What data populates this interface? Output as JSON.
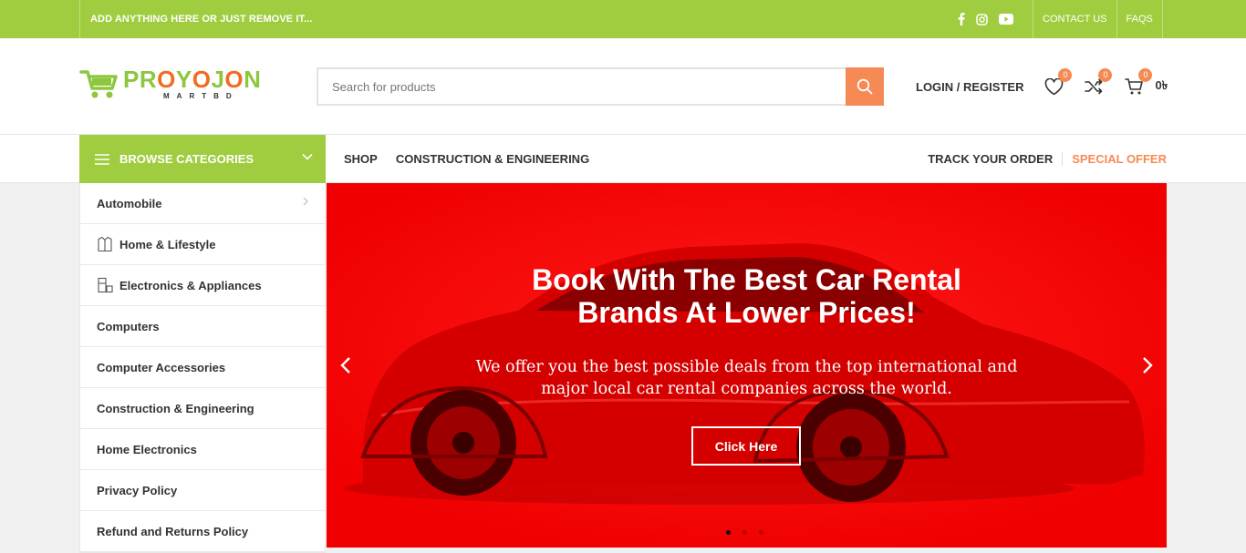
{
  "topbar": {
    "promo": "ADD ANYTHING HERE OR JUST REMOVE IT...",
    "social": [
      "facebook-icon",
      "instagram-icon",
      "youtube-icon"
    ],
    "links": [
      "CONTACT US",
      "FAQS"
    ]
  },
  "header": {
    "logo": {
      "name_a": "PR",
      "name_o1": "O",
      "name_b": "Y",
      "name_o2": "O",
      "name_c": "J",
      "name_o3": "O",
      "name_d": "N",
      "sub": "MARTBD"
    },
    "search_placeholder": "Search for products",
    "login": "LOGIN / REGISTER",
    "wishlist_count": "0",
    "compare_count": "0",
    "cart_count": "0",
    "cart_total": "0৳"
  },
  "nav": {
    "browse": "BROWSE CATEGORIES",
    "menu": [
      "SHOP",
      "CONSTRUCTION & ENGINEERING"
    ],
    "track": "TRACK YOUR ORDER",
    "offer": "SPECIAL OFFER"
  },
  "sidebar": {
    "items": [
      "Automobile",
      "Home & Lifestyle",
      "Electronics & Appliances",
      "Computers",
      "Computer Accessories",
      "Construction & Engineering",
      "Home Electronics",
      "Privacy Policy",
      "Refund and Returns Policy"
    ]
  },
  "slider": {
    "title_line1": "Book With The Best Car Rental",
    "title_line2": "Brands At Lower Prices!",
    "sub_line1": "We offer you the best possible deals from the top international and",
    "sub_line2": "major local car rental companies across the world.",
    "button": "Click Here"
  },
  "colors": {
    "green": "#a0cd3f",
    "orange": "#f58a54",
    "slider_red": "#ff0000"
  }
}
